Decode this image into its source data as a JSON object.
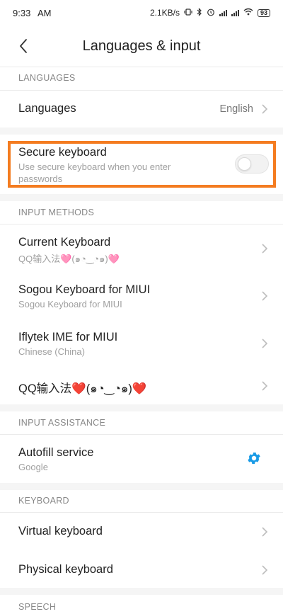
{
  "status_bar": {
    "time": "9:33",
    "ampm": "AM",
    "speed": "2.1KB/s",
    "battery": "93"
  },
  "header": {
    "title": "Languages &  input",
    "back_icon": "chevron-left-icon"
  },
  "sections": {
    "languages": "LANGUAGES",
    "input_methods": "INPUT METHODS",
    "input_assistance": "INPUT ASSISTANCE",
    "keyboard": "KEYBOARD",
    "speech": "SPEECH"
  },
  "languages_row": {
    "title": "Languages",
    "value": "English"
  },
  "secure_keyboard": {
    "title": "Secure keyboard",
    "subtitle_line1": "Use secure keyboard when you enter",
    "subtitle_line2": "passwords",
    "enabled": false,
    "highlight_color": "#f47c20"
  },
  "input_methods": [
    {
      "title": "Current Keyboard",
      "subtitle": "QQ输入法🩷(๑◔‿◔๑)🩷"
    },
    {
      "title": "Sogou Keyboard for MIUI",
      "subtitle": "Sogou Keyboard for MIUI"
    },
    {
      "title": "Iflytek IME for MIUI",
      "subtitle": "Chinese (China)"
    },
    {
      "title": "QQ输入法❤️(๑◔‿◔๑)❤️",
      "subtitle": ""
    }
  ],
  "autofill": {
    "title": "Autofill service",
    "subtitle": "Google",
    "icon": "gear-icon",
    "icon_color": "#1a9be6"
  },
  "keyboard_rows": [
    {
      "title": "Virtual keyboard"
    },
    {
      "title": "Physical keyboard"
    }
  ]
}
